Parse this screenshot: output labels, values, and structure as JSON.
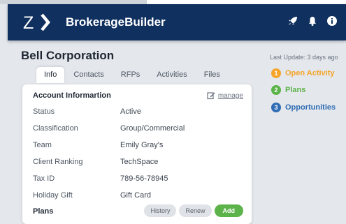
{
  "header": {
    "brand": "BrokerageBuilder",
    "icons": [
      "rocket-icon",
      "bell-icon",
      "info-icon"
    ]
  },
  "company": {
    "name": "Bell Corporation"
  },
  "tabs": [
    {
      "label": "Info",
      "active": true
    },
    {
      "label": "Contacts",
      "active": false
    },
    {
      "label": "RFPs",
      "active": false
    },
    {
      "label": "Activities",
      "active": false
    },
    {
      "label": "Files",
      "active": false
    }
  ],
  "account": {
    "title": "Account Informartion",
    "manage_label": "manage",
    "rows": [
      {
        "label": "Status",
        "value": "Active"
      },
      {
        "label": "Classification",
        "value": "Group/Commercial"
      },
      {
        "label": "Team",
        "value": "Emily Gray's"
      },
      {
        "label": "Client Ranking",
        "value": "TechSpace"
      },
      {
        "label": "Tax ID",
        "value": "789-56-78945"
      },
      {
        "label": "Holiday Gift",
        "value": "Gift Card"
      }
    ]
  },
  "plans": {
    "title": "Plans",
    "buttons": {
      "history": "History",
      "renew": "Renew",
      "add": "Add"
    }
  },
  "sidebar": {
    "last_update": "Last Update: 3 days ago",
    "items": [
      {
        "number": "1",
        "label": "Open Activity",
        "color": "#f4a52a"
      },
      {
        "number": "2",
        "label": "Plans",
        "color": "#5cb34a"
      },
      {
        "number": "3",
        "label": "Opportunities",
        "color": "#2f6cb3"
      }
    ]
  },
  "colors": {
    "header_bg": "#10305f",
    "accent_green": "#5cb34a",
    "accent_orange": "#f4a52a",
    "accent_blue": "#2f6cb3"
  }
}
